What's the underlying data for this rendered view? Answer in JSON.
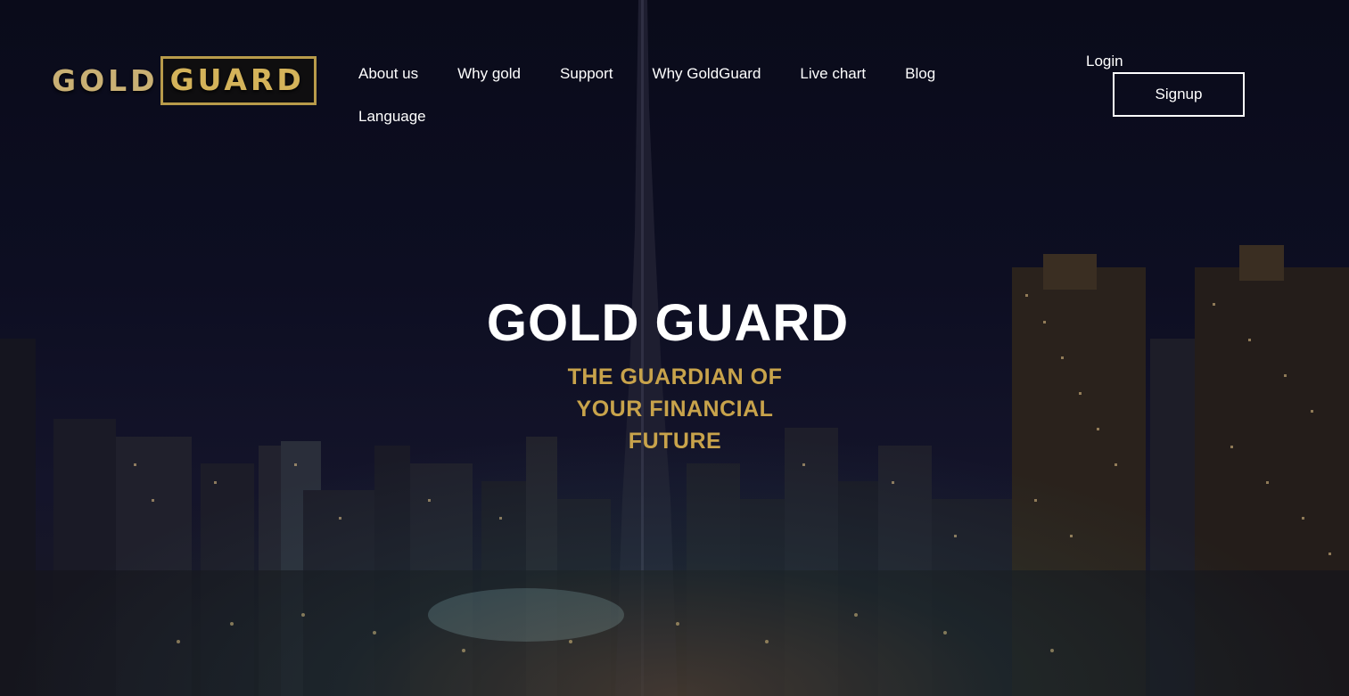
{
  "brand": {
    "logo_part1": "GOLD",
    "logo_part2": "GUARD",
    "gold_color": "#c8a34b"
  },
  "nav": {
    "items": [
      {
        "label": "About us"
      },
      {
        "label": "Why gold"
      },
      {
        "label": "Support"
      },
      {
        "label": "Why GoldGuard"
      },
      {
        "label": "Live chart"
      },
      {
        "label": "Blog"
      },
      {
        "label": "Language"
      }
    ]
  },
  "auth": {
    "login_label": "Login",
    "signup_label": "Signup"
  },
  "hero": {
    "title": "GOLD GUARD",
    "subtitle_lines": [
      "THE GUARDIAN OF",
      "YOUR FINANCIAL",
      "FUTURE"
    ]
  }
}
